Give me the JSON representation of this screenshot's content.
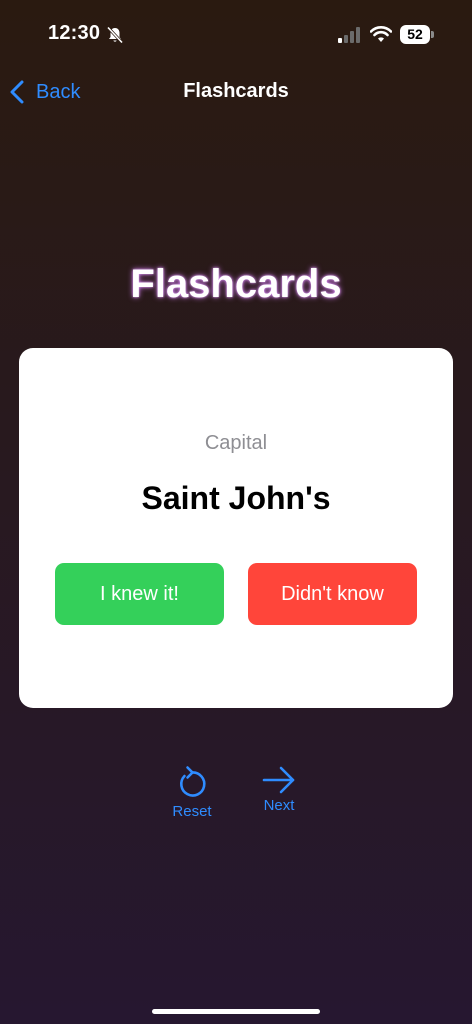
{
  "status_bar": {
    "time": "12:30",
    "battery_level": "52",
    "icons": [
      "bell-slash-icon",
      "cellular-signal-icon",
      "wifi-icon"
    ]
  },
  "nav": {
    "back_label": "Back",
    "title": "Flashcards"
  },
  "page": {
    "title": "Flashcards"
  },
  "card": {
    "category": "Capital",
    "answer": "Saint John's",
    "knew_label": "I knew it!",
    "didnt_label": "Didn't know"
  },
  "controls": {
    "reset_label": "Reset",
    "next_label": "Next"
  },
  "colors": {
    "accent": "#2f8cff",
    "knew_button": "#34d05a",
    "didnt_button": "#ff453a",
    "card_background": "#ffffff",
    "category_text": "#8e8e93"
  }
}
